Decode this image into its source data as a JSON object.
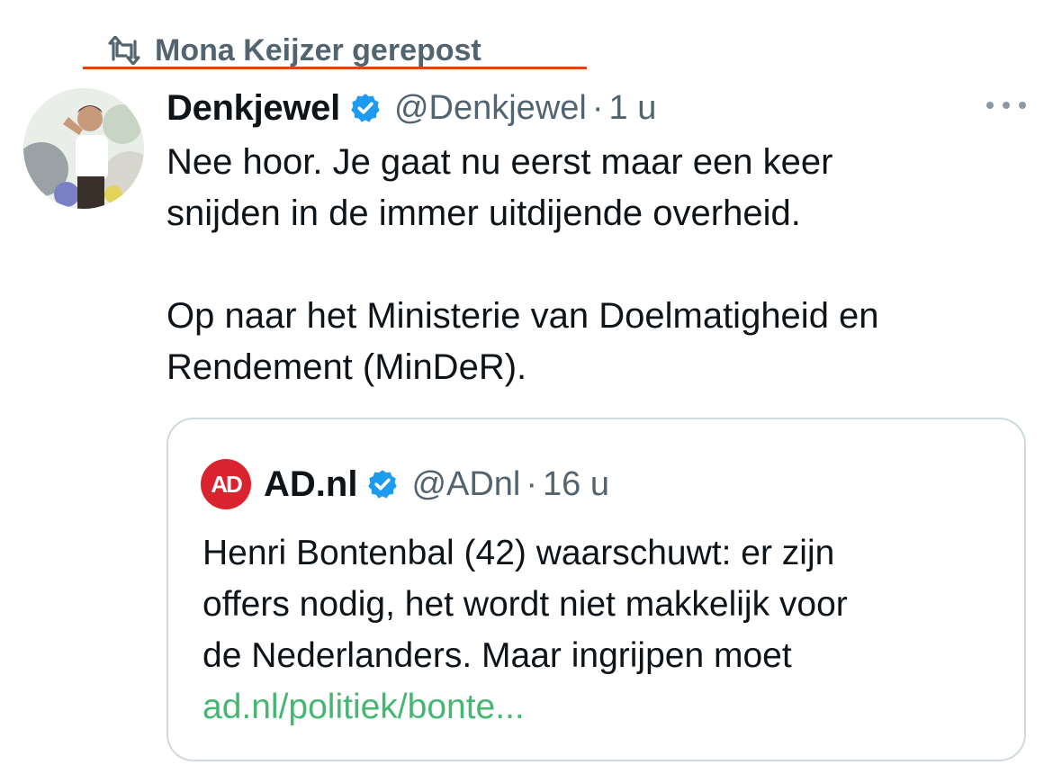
{
  "repost": {
    "label": "Mona Keijzer gerepost",
    "icon": "repost-icon",
    "underline_color": "#e0431b"
  },
  "tweet": {
    "author_name": "Denkjewel",
    "handle": "@Denkjewel",
    "separator": "·",
    "time": "1 u",
    "verified": true,
    "text_lines": [
      "Nee hoor. Je gaat nu eerst maar een keer",
      "snijden in de immer uitdijende overheid.",
      "Op naar het Ministerie van Doelmatigheid en",
      "Rendement (MinDeR)."
    ]
  },
  "quote": {
    "logo_text": "AD",
    "author_name": "AD.nl",
    "handle": "@ADnl",
    "separator": "·",
    "time": "16 u",
    "verified": true,
    "text_lines": [
      "Henri Bontenbal (42) waarschuwt: er zijn",
      "offers nodig, het wordt niet makkelijk voor",
      "de Nederlanders. Maar ingrijpen moet"
    ],
    "link": "ad.nl/politiek/bonte..."
  },
  "colors": {
    "text": "#0f1419",
    "muted": "#536471",
    "verified_blue": "#1d9bf0",
    "link_green": "#44b873",
    "ad_red": "#d9232e",
    "border": "#cfd9de"
  }
}
